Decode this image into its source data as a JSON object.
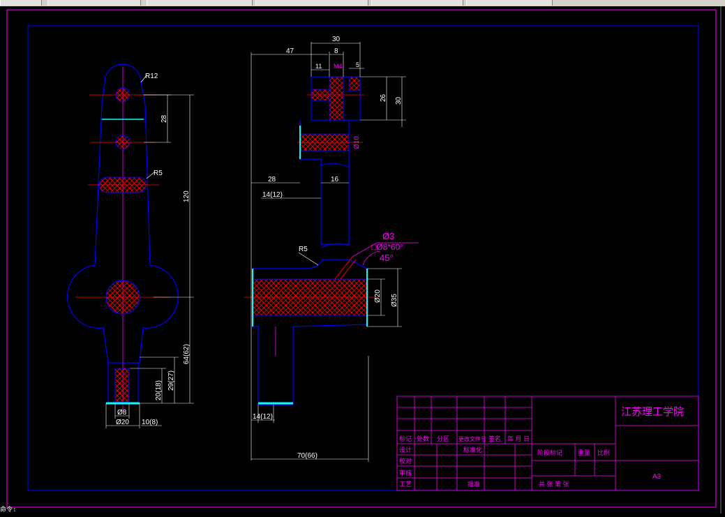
{
  "tabs": [
    "",
    "",
    "",
    "",
    "",
    ""
  ],
  "colors": {
    "outline": "#0000ff",
    "center": "#ff0000",
    "dim": "#ffffff",
    "hatch": "#ff0000",
    "frame": "#ff00ff",
    "accent": "#ff00ff",
    "edge": "#00ffff"
  },
  "front_view": {
    "r12": "R12",
    "r5": "R5",
    "d28": "28",
    "d120": "120",
    "d64": "64(62)",
    "d29": "29(27)",
    "d20v": "20(18)",
    "phi8": "Ø8",
    "phi20": "Ø20",
    "d10": "10(8)"
  },
  "side_view": {
    "d47": "47",
    "d30top": "30",
    "d8": "8",
    "d11": "11",
    "m4": "M4",
    "d5": "5",
    "d26": "26",
    "d30side": "30",
    "phi10": "Ø10",
    "d28": "28",
    "d16": "16",
    "d14a": "14(12)",
    "r5": "R5",
    "phi3": "Ø3",
    "spot": "□Ø8*60°",
    "ang45": "45°",
    "phi20": "Ø20",
    "phi35": "Ø35",
    "d14b": "14(12)",
    "d70": "70(66)"
  },
  "title_block": {
    "school": "江苏理工学院",
    "sheet": "A3",
    "h1": "标记",
    "h2": "处数",
    "h3": "分区",
    "h4": "更改文件号",
    "h5": "签名",
    "h6": "年 月 日",
    "design": "设计",
    "standard": "标准化",
    "check": "校对",
    "review": "审核",
    "process": "工艺",
    "approve": "批准",
    "stage": "阶段标记",
    "weight": "重量",
    "scale": "比例",
    "sheets": "共   张   第   张"
  },
  "command_line": "命令:"
}
